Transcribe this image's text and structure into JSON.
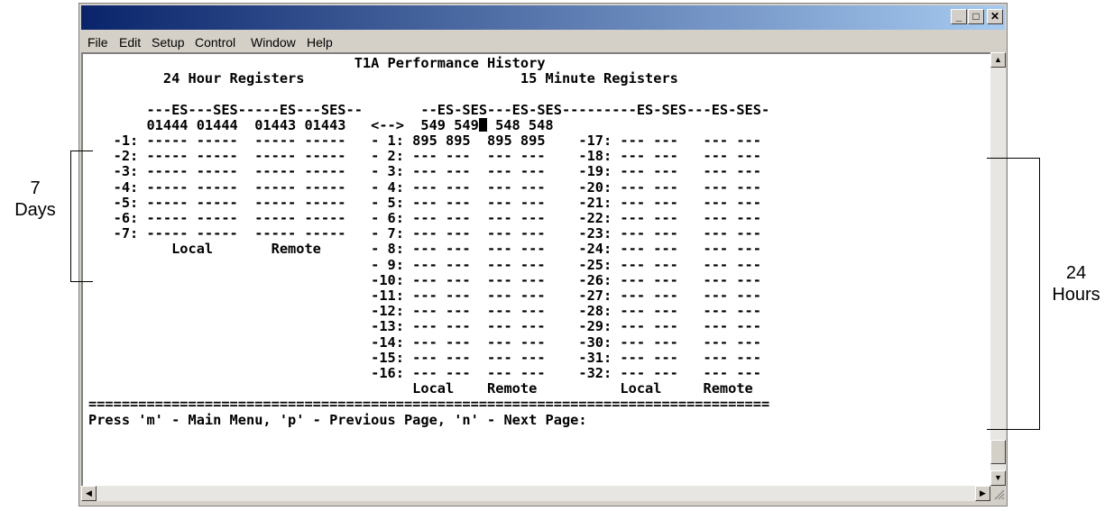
{
  "window": {
    "title": "",
    "controls": {
      "minimize": "_",
      "maximize": "□",
      "close": "✕"
    }
  },
  "menu": [
    "File",
    "Edit",
    "Setup",
    "Control",
    "Window",
    "Help"
  ],
  "terminal": {
    "lines": [
      "                                T1A Performance History",
      "         24 Hour Registers                          15 Minute Registers",
      "",
      "       ---ES---SES-----ES---SES--       --ES-SES---ES-SES---------ES-SES---ES-SES-",
      "       01444 01444  01443 01443   <-->  549 549",
      "   -1: ----- -----  ----- -----   - 1: 895 895  895 895    -17: --- ---   --- ---",
      "   -2: ----- -----  ----- -----   - 2: --- ---  --- ---    -18: --- ---   --- ---",
      "   -3: ----- -----  ----- -----   - 3: --- ---  --- ---    -19: --- ---   --- ---",
      "   -4: ----- -----  ----- -----   - 4: --- ---  --- ---    -20: --- ---   --- ---",
      "   -5: ----- -----  ----- -----   - 5: --- ---  --- ---    -21: --- ---   --- ---",
      "   -6: ----- -----  ----- -----   - 6: --- ---  --- ---    -22: --- ---   --- ---",
      "   -7: ----- -----  ----- -----   - 7: --- ---  --- ---    -23: --- ---   --- ---",
      "          Local       Remote      - 8: --- ---  --- ---    -24: --- ---   --- ---",
      "                                  - 9: --- ---  --- ---    -25: --- ---   --- ---",
      "                                  -10: --- ---  --- ---    -26: --- ---   --- ---",
      "                                  -11: --- ---  --- ---    -27: --- ---   --- ---",
      "                                  -12: --- ---  --- ---    -28: --- ---   --- ---",
      "                                  -13: --- ---  --- ---    -29: --- ---   --- ---",
      "                                  -14: --- ---  --- ---    -30: --- ---   --- ---",
      "                                  -15: --- ---  --- ---    -31: --- ---   --- ---",
      "                                  -16: --- ---  --- ---    -32: --- ---   --- ---",
      "                                       Local    Remote          Local     Remote",
      "==================================================================================",
      "Press 'm' - Main Menu, 'p' - Previous Page, 'n' - Next Page:"
    ],
    "cursor_line_suffix": " 548 548"
  },
  "annotations": {
    "days": "7\nDays",
    "hours": "24\nHours"
  }
}
